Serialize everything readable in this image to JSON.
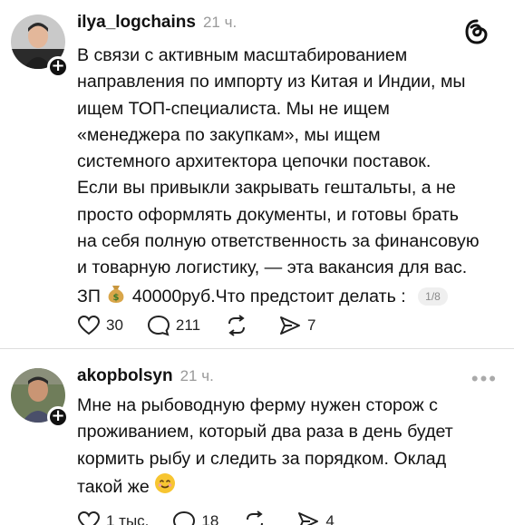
{
  "post1": {
    "username": "ilya_logchains",
    "time": "21 ч.",
    "lines": [
      "В связи с активным масштабированием",
      "направления по импорту из Китая и Индии, мы",
      "ищем ТОП-специалиста. Мы не ищем",
      "«менеджера по закупкам», мы ищем",
      "системного архитектора цепочки поставок.",
      "Если вы привыкли закрывать гештальты, а не",
      "просто оформлять документы, и готовы брать",
      "на себя полную ответственность за финансовую",
      "и товарную логистику, — эта вакансия для вас."
    ],
    "last_line_prefix": "ЗП",
    "last_line_suffix": "40000руб.Что предстоит делать :",
    "pager": "1/8",
    "likes": "30",
    "comments": "211",
    "reposts": "",
    "shares": "7"
  },
  "post2": {
    "username": "akopbolsyn",
    "time": "21 ч.",
    "lines": [
      "Мне на рыбоводную ферму нужен сторож с",
      "проживанием, который два раза в день будет",
      "кормить рыбу и следить за порядком. Оклад"
    ],
    "last_line": "такой же",
    "likes": "1 тыс.",
    "comments": "18",
    "shares": "4"
  },
  "colors": {
    "text": "#111111",
    "muted": "#9a9a9a",
    "divider": "#dedede",
    "emoji_yellow": "#f7c531"
  },
  "icons": {
    "logo": "threads-logo-icon",
    "like": "heart-icon",
    "comment": "comment-bubble-icon",
    "repost": "repost-icon",
    "share": "send-icon",
    "money": "money-bag-emoji",
    "smile": "smiling-face-emoji",
    "more": "more-dots-icon"
  }
}
